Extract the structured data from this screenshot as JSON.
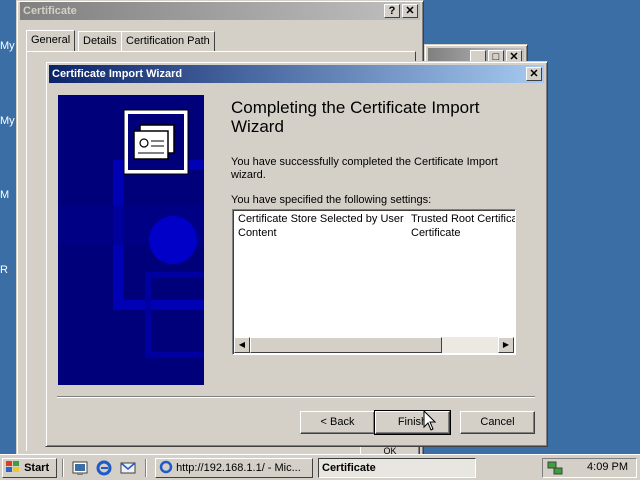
{
  "desktop": {
    "labels": [
      "My",
      "My",
      "M",
      "R"
    ]
  },
  "cert_window": {
    "title": "Certificate",
    "tabs": [
      "General",
      "Details",
      "Certification Path"
    ],
    "ok_label": "OK"
  },
  "wizard": {
    "title": "Certificate Import Wizard",
    "heading": "Completing the Certificate Import Wizard",
    "message": "You have successfully completed the Certificate Import wizard.",
    "settings_label": "You have specified the following settings:",
    "settings": [
      {
        "name": "Certificate Store Selected by User",
        "value": "Trusted Root Certifica"
      },
      {
        "name": "Content",
        "value": "Certificate"
      }
    ],
    "buttons": {
      "back": "< Back",
      "finish": "Finish",
      "cancel": "Cancel"
    }
  },
  "taskbar": {
    "start": "Start",
    "tasks": [
      "http://192.168.1.1/ - Mic...",
      "Certificate"
    ],
    "clock": "4:09 PM"
  },
  "colors": {
    "desktop": "#3a6ea5",
    "active_title": "#0a246a",
    "wizard_art": "#00007a"
  }
}
